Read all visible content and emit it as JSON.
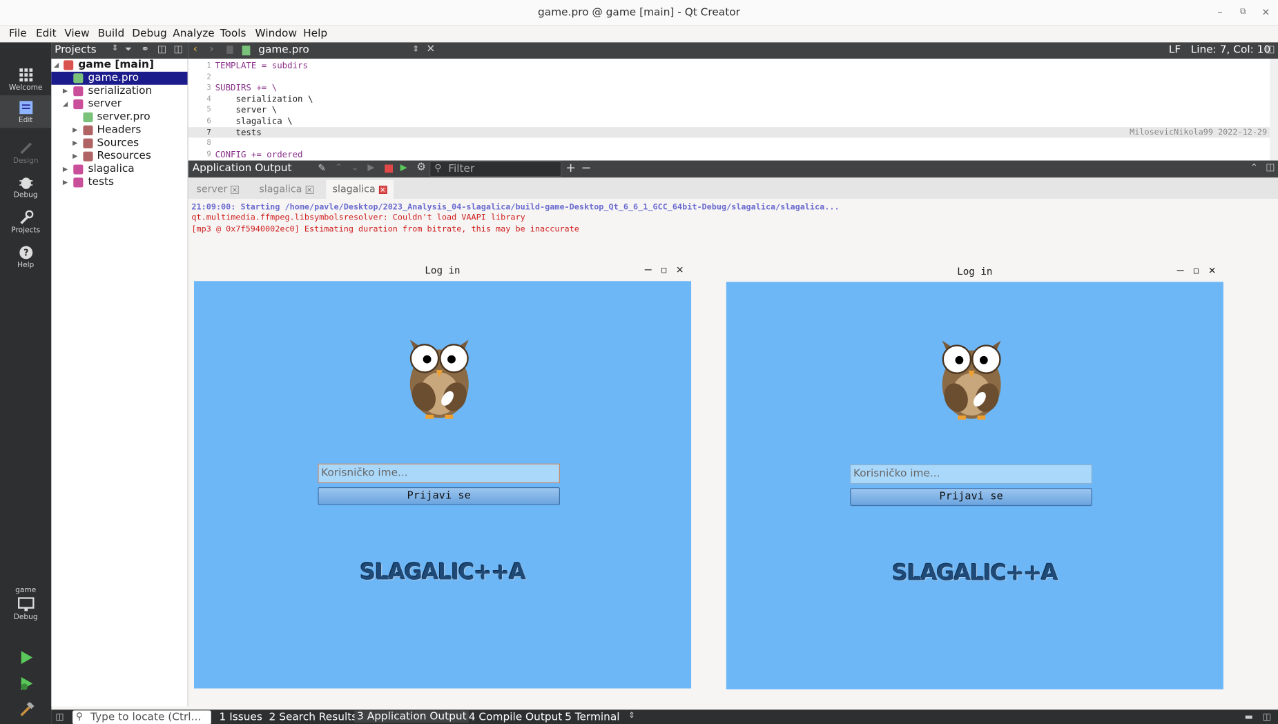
{
  "window": {
    "title": "game.pro @ game [main] - Qt Creator"
  },
  "menu": [
    "File",
    "Edit",
    "View",
    "Build",
    "Debug",
    "Analyze",
    "Tools",
    "Window",
    "Help"
  ],
  "modes": {
    "welcome": "Welcome",
    "edit": "Edit",
    "design": "Design",
    "debug": "Debug",
    "projects": "Projects",
    "help": "Help",
    "target_kit": "game",
    "target_mode": "Debug"
  },
  "projects": {
    "header": "Projects",
    "tree": [
      "game [main]",
      "game.pro",
      "serialization",
      "server",
      "server.pro",
      "Headers",
      "Sources",
      "Resources",
      "slagalica",
      "tests"
    ]
  },
  "editor": {
    "file": "game.pro",
    "line_ending": "LF",
    "position": "Line: 7, Col: 10",
    "blame": "MilosevicNikola99 2022-12-29",
    "lines": [
      {
        "n": "1",
        "code": "TEMPLATE = subdirs"
      },
      {
        "n": "2",
        "code": ""
      },
      {
        "n": "3",
        "code": "SUBDIRS += \\"
      },
      {
        "n": "4",
        "code": "    serialization \\"
      },
      {
        "n": "5",
        "code": "    server \\"
      },
      {
        "n": "6",
        "code": "    slagalica \\"
      },
      {
        "n": "7",
        "code": "    tests"
      },
      {
        "n": "8",
        "code": ""
      },
      {
        "n": "9",
        "code": "CONFIG += ordered"
      }
    ]
  },
  "output": {
    "title": "Application Output",
    "filter_placeholder": "Filter",
    "tabs": [
      "server",
      "slagalica",
      "slagalica"
    ],
    "lines": [
      "21:09:00: Starting /home/pavle/Desktop/2023_Analysis_04-slagalica/build-game-Desktop_Qt_6_6_1_GCC_64bit-Debug/slagalica/slagalica...",
      "qt.multimedia.ffmpeg.libsymbolsresolver: Couldn't load VAAPI library",
      "[mp3 @ 0x7f5940002ec0] Estimating duration from bitrate, this may be inaccurate"
    ]
  },
  "login_windows": [
    {
      "title": "Log in",
      "placeholder": "Korisničko ime...",
      "button": "Prijavi se",
      "logo": "SLAGALIC++A"
    },
    {
      "title": "Log in",
      "placeholder": "Korisničko ime...",
      "button": "Prijavi se",
      "logo": "SLAGALIC++A"
    }
  ],
  "statusbar": {
    "locate_placeholder": "Type to locate (Ctrl...",
    "panes": [
      "1  Issues",
      "2  Search Results",
      "3  Application Output",
      "4  Compile Output",
      "5  Terminal"
    ]
  },
  "colors": {
    "dark": "#404244",
    "accent": "#1b1b8c",
    "login_bg": "#6db7f7",
    "output_header": "#6b6bd0",
    "output_error": "#d02020"
  }
}
